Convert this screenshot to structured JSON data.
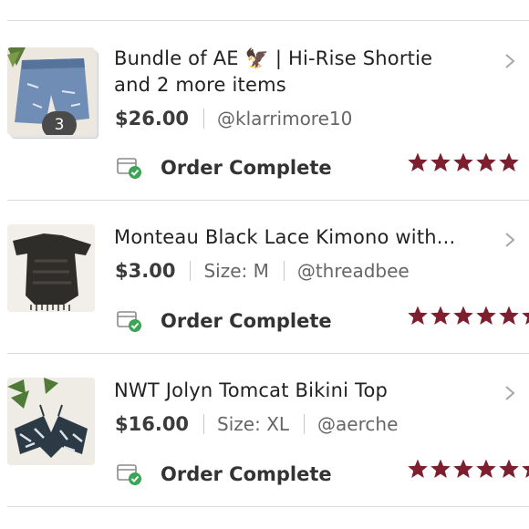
{
  "orders": [
    {
      "title_line1": "Bundle of AE 🦅 | Hi-Rise Shortie",
      "title_line2": "and 2 more items",
      "price": "$26.00",
      "seller": "@klarrimore10",
      "bundle_count": "3",
      "status": "Order Complete",
      "rating": 5,
      "thumbnail": "denim-shorts-photo"
    },
    {
      "title": "Monteau Black Lace Kimono with...",
      "price": "$3.00",
      "size": "Size: M",
      "seller": "@threadbee",
      "status": "Order Complete",
      "rating": 5,
      "thumbnail": "black-lace-kimono-photo"
    },
    {
      "title": "NWT Jolyn Tomcat Bikini Top",
      "price": "$16.00",
      "size": "Size: XL",
      "seller": "@aerche",
      "status": "Order Complete",
      "rating": 5,
      "thumbnail": "bikini-top-photo"
    }
  ],
  "colors": {
    "star": "#7d1f2f",
    "check": "#3aa655",
    "divider": "#dcdcdc"
  },
  "icons": {
    "status": "shipping-box-check-icon",
    "chevron": "chevron-right-icon",
    "rating": "star-icon"
  }
}
